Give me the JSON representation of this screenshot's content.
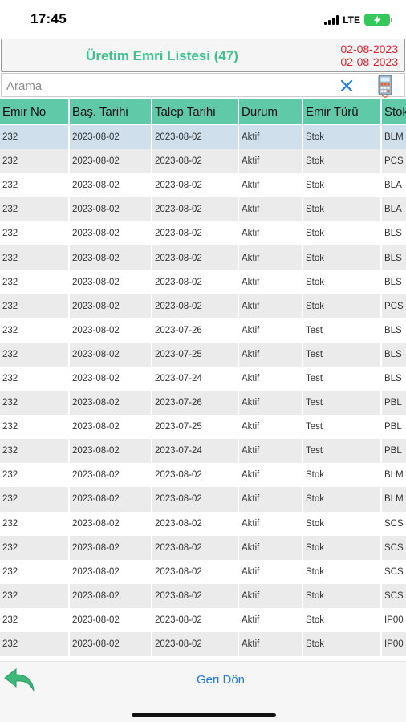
{
  "status_bar": {
    "time": "17:45",
    "network": "LTE"
  },
  "header": {
    "title": "Üretim Emri Listesi (47)",
    "date_start": "02-08-2023",
    "date_end": "02-08-2023"
  },
  "search": {
    "placeholder": "Arama",
    "value": ""
  },
  "columns": [
    "Emir No",
    "Baş. Tarihi",
    "Talep Tarihi",
    "Durum",
    "Emir Türü",
    "Stok"
  ],
  "rows": [
    [
      "232",
      "2023-08-02",
      "2023-08-02",
      "Aktif",
      "Stok",
      "BLM"
    ],
    [
      "232",
      "2023-08-02",
      "2023-08-02",
      "Aktif",
      "Stok",
      "PCS"
    ],
    [
      "232",
      "2023-08-02",
      "2023-08-02",
      "Aktif",
      "Stok",
      "BLA"
    ],
    [
      "232",
      "2023-08-02",
      "2023-08-02",
      "Aktif",
      "Stok",
      "BLA"
    ],
    [
      "232",
      "2023-08-02",
      "2023-08-02",
      "Aktif",
      "Stok",
      "BLS"
    ],
    [
      "232",
      "2023-08-02",
      "2023-08-02",
      "Aktif",
      "Stok",
      "BLS"
    ],
    [
      "232",
      "2023-08-02",
      "2023-08-02",
      "Aktif",
      "Stok",
      "BLS"
    ],
    [
      "232",
      "2023-08-02",
      "2023-08-02",
      "Aktif",
      "Stok",
      "PCS"
    ],
    [
      "232",
      "2023-08-02",
      "2023-07-26",
      "Aktif",
      "Test",
      "BLS"
    ],
    [
      "232",
      "2023-08-02",
      "2023-07-25",
      "Aktif",
      "Test",
      "BLS"
    ],
    [
      "232",
      "2023-08-02",
      "2023-07-24",
      "Aktif",
      "Test",
      "BLS"
    ],
    [
      "232",
      "2023-08-02",
      "2023-07-26",
      "Aktif",
      "Test",
      "PBL"
    ],
    [
      "232",
      "2023-08-02",
      "2023-07-25",
      "Aktif",
      "Test",
      "PBL"
    ],
    [
      "232",
      "2023-08-02",
      "2023-07-24",
      "Aktif",
      "Test",
      "PBL"
    ],
    [
      "232",
      "2023-08-02",
      "2023-08-02",
      "Aktif",
      "Stok",
      "BLM"
    ],
    [
      "232",
      "2023-08-02",
      "2023-08-02",
      "Aktif",
      "Stok",
      "BLM"
    ],
    [
      "232",
      "2023-08-02",
      "2023-08-02",
      "Aktif",
      "Stok",
      "SCS"
    ],
    [
      "232",
      "2023-08-02",
      "2023-08-02",
      "Aktif",
      "Stok",
      "SCS"
    ],
    [
      "232",
      "2023-08-02",
      "2023-08-02",
      "Aktif",
      "Stok",
      "SCS"
    ],
    [
      "232",
      "2023-08-02",
      "2023-08-02",
      "Aktif",
      "Stok",
      "SCS"
    ],
    [
      "232",
      "2023-08-02",
      "2023-08-02",
      "Aktif",
      "Stok",
      "IP00"
    ],
    [
      "232",
      "2023-08-02",
      "2023-08-02",
      "Aktif",
      "Stok",
      "IP00"
    ]
  ],
  "selected_row": 0,
  "footer": {
    "back_label": "Geri Dön"
  },
  "colors": {
    "title_green": "#3cc48f",
    "date_red": "#ee1c25",
    "header_green": "#60c9a7",
    "link_blue": "#1e7be8",
    "selected_row": "#cfe0ec"
  }
}
